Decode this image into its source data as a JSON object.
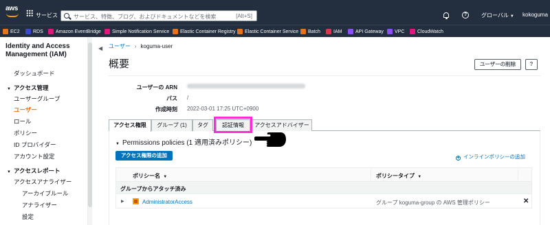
{
  "topnav": {
    "logo_text": "aws",
    "services_label": "サービス",
    "search_placeholder": "サービス、特徴、ブログ、およびドキュメントなどを検索",
    "search_shortcut": "[Alt+S]",
    "region_label": "グローバル",
    "account_label": "kokoguma"
  },
  "favorites": [
    {
      "label": "EC2",
      "color": "#ec7211"
    },
    {
      "label": "RDS",
      "color": "#3b48cc"
    },
    {
      "label": "Amazon EventBridge",
      "color": "#e7157b"
    },
    {
      "label": "Simple Notification Service",
      "color": "#e7157b"
    },
    {
      "label": "Elastic Container Registry",
      "color": "#ec7211"
    },
    {
      "label": "Elastic Container Service",
      "color": "#ec7211"
    },
    {
      "label": "Batch",
      "color": "#ec7211"
    },
    {
      "label": "IAM",
      "color": "#dd344c"
    },
    {
      "label": "API Gateway",
      "color": "#8c4fff"
    },
    {
      "label": "VPC",
      "color": "#8c4fff"
    },
    {
      "label": "CloudWatch",
      "color": "#e7157b"
    }
  ],
  "sidebar": {
    "title": "Identity and Access Management (IAM)",
    "items": [
      {
        "label": "ダッシュボード"
      },
      {
        "label": "アクセス管理"
      },
      {
        "label": "ユーザーグループ"
      },
      {
        "label": "ユーザー"
      },
      {
        "label": "ロール"
      },
      {
        "label": "ポリシー"
      },
      {
        "label": "ID プロバイダー"
      },
      {
        "label": "アカウント設定"
      },
      {
        "label": "アクセスレポート"
      },
      {
        "label": "アクセスアナライザー"
      },
      {
        "label": "アーカイブルール"
      },
      {
        "label": "アナライザー"
      },
      {
        "label": "設定"
      }
    ]
  },
  "breadcrumb": {
    "parent": "ユーザー",
    "separator": "›",
    "current": "koguma-user"
  },
  "page": {
    "title": "概要",
    "delete_button": "ユーザーの削除",
    "help_button": "?"
  },
  "summary": {
    "arn_label": "ユーザーの ARN",
    "path_label": "パス",
    "path_value": "/",
    "created_label": "作成時刻",
    "created_value": "2022-03-01 17:25 UTC+0900"
  },
  "tabs": [
    {
      "label": "アクセス権限",
      "active": true
    },
    {
      "label": "グループ (1)",
      "active": false
    },
    {
      "label": "タグ",
      "active": false
    },
    {
      "label": "認証情報",
      "active": false
    },
    {
      "label": "アクセスアドバイザー",
      "active": false
    }
  ],
  "permissions": {
    "title": "Permissions policies (1 適用済みポリシー)",
    "add_button": "アクセス権限の追加",
    "add_inline": "インラインポリシーの追加",
    "columns": [
      "ポリシー名",
      "ポリシータイプ"
    ],
    "group_label": "グループからアタッチ済み",
    "rows": [
      {
        "name": "AdministratorAccess",
        "type": "グループ koguma-group の AWS 管理ポリシー"
      }
    ]
  },
  "colors": {
    "highlight": "#ff2bd9",
    "accent": "#ec7211",
    "link": "#0073bb"
  }
}
